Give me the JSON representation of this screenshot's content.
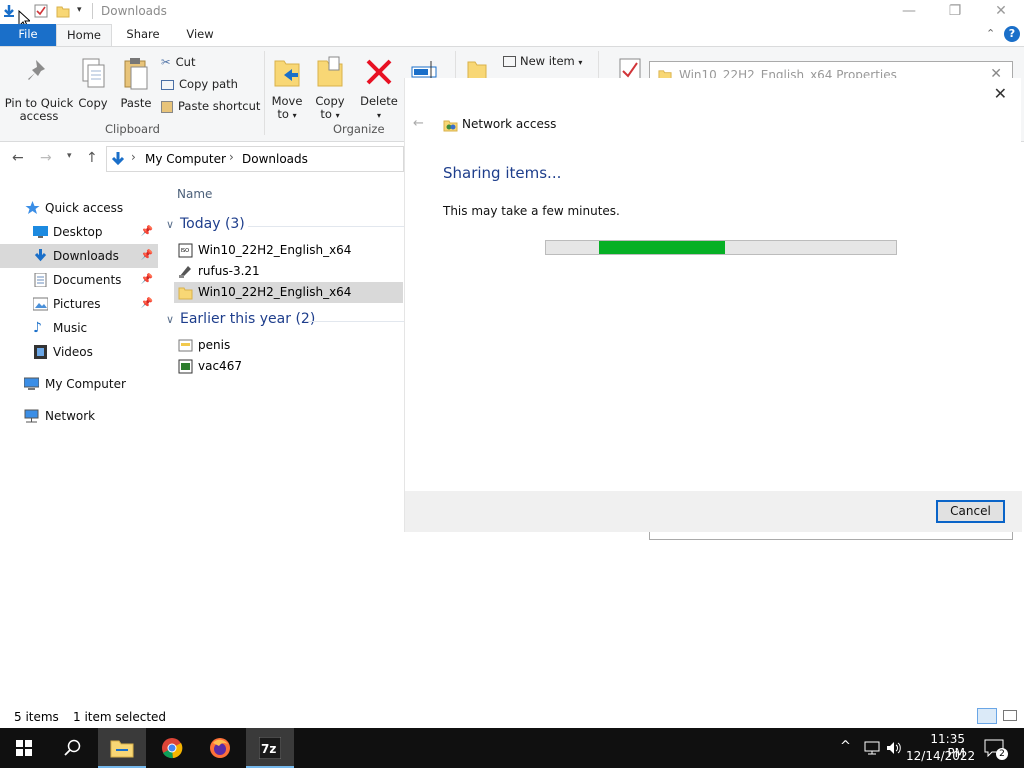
{
  "window": {
    "title": "Downloads",
    "controls": {
      "minimize": "—",
      "maximize": "❐",
      "close": "✕"
    }
  },
  "ribbon_tabs": [
    {
      "label": "File"
    },
    {
      "label": "Home"
    },
    {
      "label": "Share"
    },
    {
      "label": "View"
    }
  ],
  "ribbon": {
    "clipboard": {
      "pin_label": "Pin to Quick access",
      "copy_label": "Copy",
      "paste_label": "Paste",
      "cut_label": "Cut",
      "copy_path_label": "Copy path",
      "paste_shortcut_label": "Paste shortcut",
      "group_label": "Clipboard"
    },
    "organize": {
      "move_label": "Move to",
      "copy_to_label": "Copy to",
      "delete_label": "Delete",
      "group_label": "Organize"
    },
    "new": {
      "new_item_label": "New item"
    }
  },
  "address": {
    "path": [
      "My Computer",
      "Downloads"
    ]
  },
  "nav_pane": [
    {
      "label": "Quick access",
      "icon": "star-icon"
    },
    {
      "label": "Desktop",
      "icon": "desktop-icon",
      "pinned": true
    },
    {
      "label": "Downloads",
      "icon": "download-icon",
      "pinned": true,
      "selected": true
    },
    {
      "label": "Documents",
      "icon": "documents-icon",
      "pinned": true
    },
    {
      "label": "Pictures",
      "icon": "pictures-icon",
      "pinned": true
    },
    {
      "label": "Music",
      "icon": "music-icon"
    },
    {
      "label": "Videos",
      "icon": "videos-icon"
    },
    {
      "label": "My Computer",
      "icon": "computer-icon"
    },
    {
      "label": "Network",
      "icon": "network-icon"
    }
  ],
  "file_list": {
    "column_name": "Name",
    "groups": [
      {
        "label": "Today (3)",
        "files": [
          {
            "name": "Win10_22H2_English_x64",
            "icon": "iso-icon"
          },
          {
            "name": "rufus-3.21",
            "icon": "rufus-icon"
          },
          {
            "name": "Win10_22H2_English_x64",
            "icon": "folder-icon",
            "selected": true
          }
        ]
      },
      {
        "label": "Earlier this year (2)",
        "files": [
          {
            "name": "penis",
            "icon": "document-icon"
          },
          {
            "name": "vac467",
            "icon": "exe-icon"
          }
        ]
      }
    ]
  },
  "status_bar": {
    "item_count": "5 items",
    "selection": "1 item selected"
  },
  "properties_dialog": {
    "title": "Win10_22H2_English_x64 Properties"
  },
  "network_dialog": {
    "breadcrumb": "Network access",
    "heading": "Sharing items...",
    "message": "This may take a few minutes.",
    "progress_start": 0.15,
    "progress_end": 0.51,
    "cancel_label": "Cancel"
  },
  "taskbar": {
    "time": "11:35 PM",
    "date": "12/14/2022",
    "notification_count": "2",
    "apps": [
      "start-icon",
      "search-icon",
      "file-explorer-icon",
      "chrome-icon",
      "firefox-icon",
      "7zip-icon"
    ]
  },
  "colors": {
    "accent": "#1a6fc9",
    "progress": "#06b025",
    "heading": "#1e3e8c"
  }
}
